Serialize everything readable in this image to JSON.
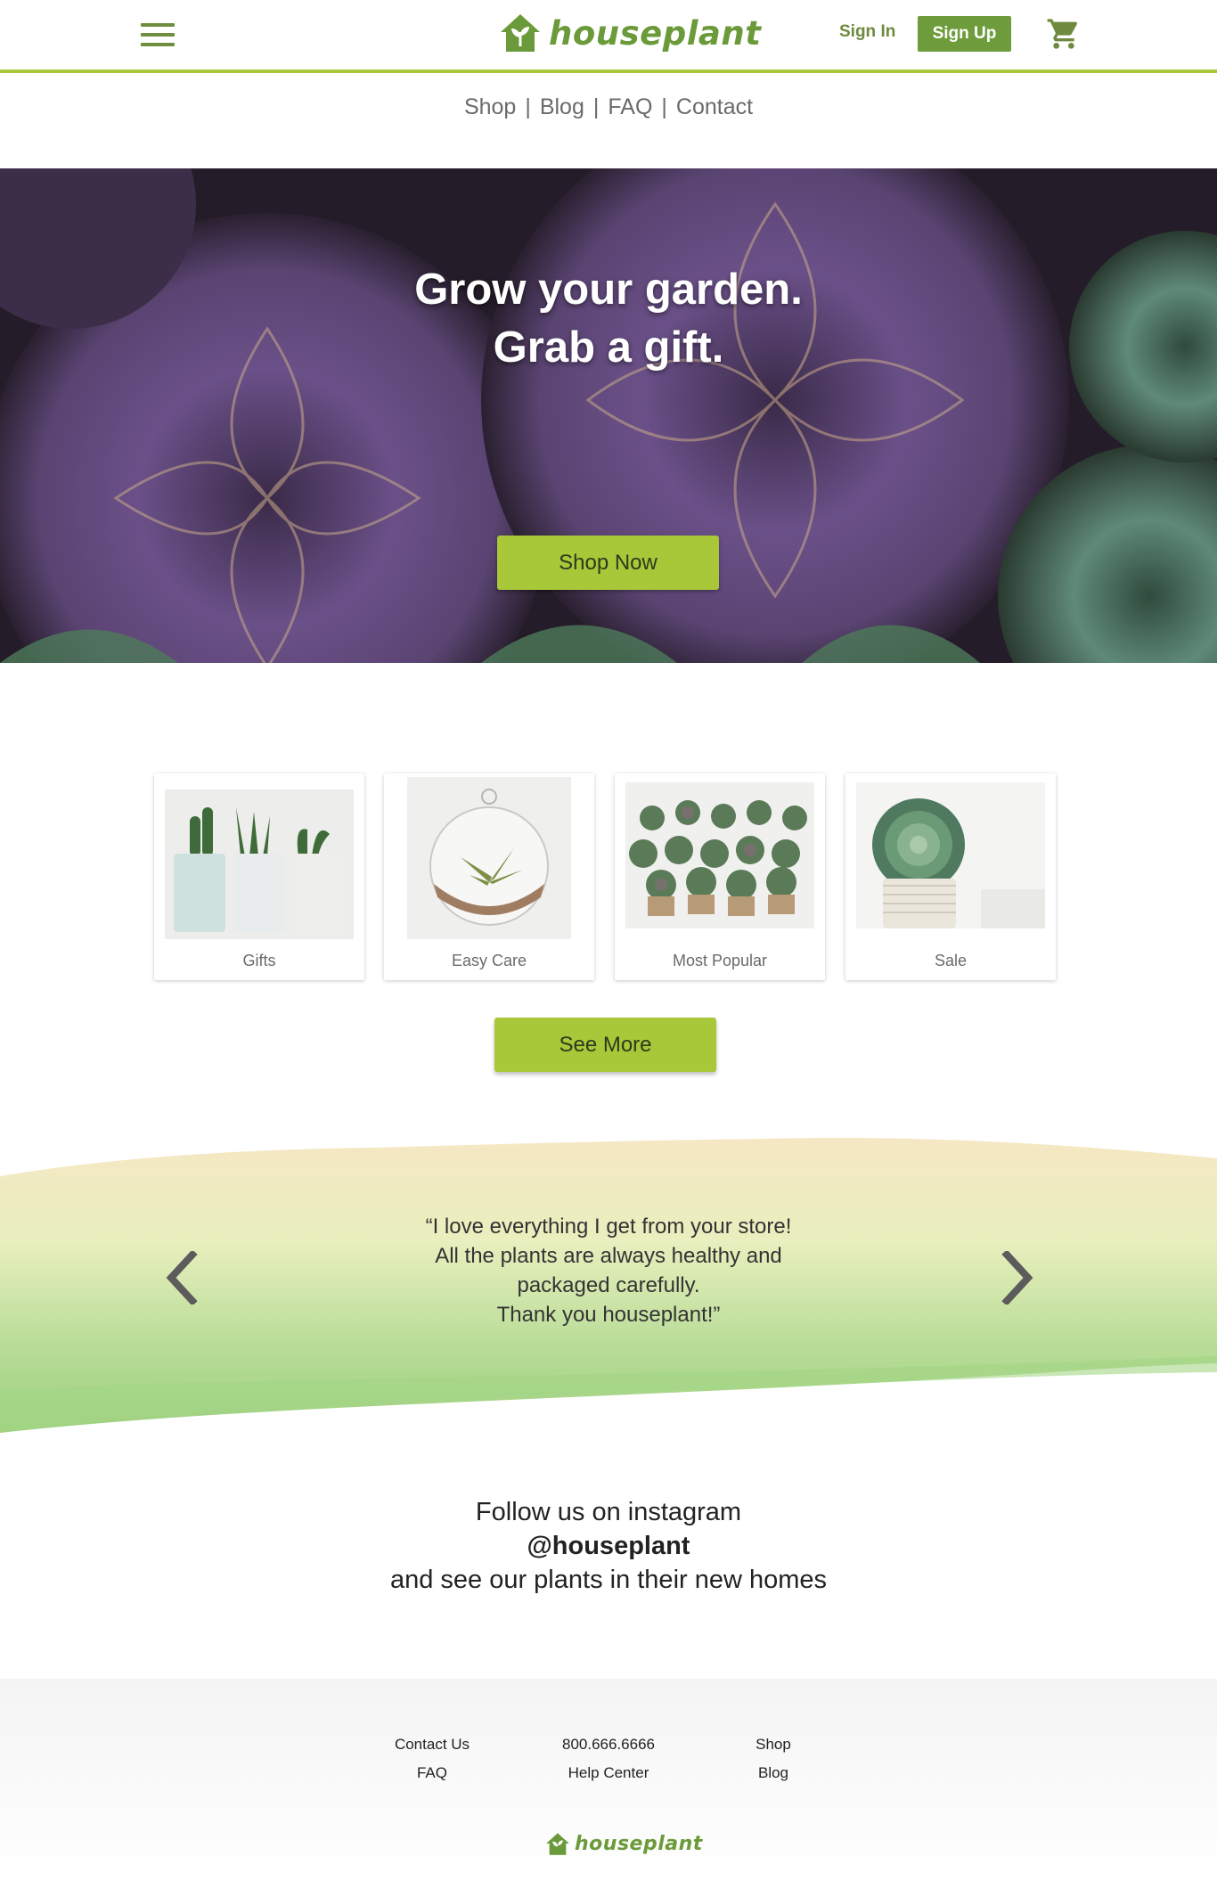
{
  "header": {
    "logo_text": "houseplant",
    "signin_label": "Sign In",
    "signup_label": "Sign Up",
    "icons": {
      "menu": "hamburger-menu-icon",
      "cart": "shopping-cart-icon",
      "logo": "house-plant-logo-icon"
    }
  },
  "subnav": {
    "items": [
      "Shop",
      "Blog",
      "FAQ",
      "Contact"
    ],
    "separator": "|"
  },
  "hero": {
    "line1": "Grow your garden.",
    "line2": "Grab a gift.",
    "button_label": "Shop Now"
  },
  "categories": [
    {
      "label": "Gifts"
    },
    {
      "label": "Easy Care"
    },
    {
      "label": "Most Popular"
    },
    {
      "label": "Sale"
    }
  ],
  "see_more_label": "See More",
  "testimonial": {
    "lines": [
      "“I love everything I get from your store!",
      "All the plants are always healthy and",
      "packaged carefully.",
      "Thank you houseplant!”"
    ],
    "icons": {
      "prev": "chevron-left-icon",
      "next": "chevron-right-icon"
    }
  },
  "instagram": {
    "line1": "Follow us on instagram",
    "handle": "@houseplant",
    "line3": "and see our plants in their new homes"
  },
  "footer": {
    "col1": [
      "Contact Us",
      "FAQ"
    ],
    "col2": [
      "800.666.6666",
      "Help Center"
    ],
    "col3": [
      "Shop",
      "Blog"
    ],
    "logo_text": "houseplant"
  },
  "colors": {
    "brand_green": "#6e9c3d",
    "accent_lime": "#a8c83a",
    "text_gray": "#6a6a6a"
  }
}
